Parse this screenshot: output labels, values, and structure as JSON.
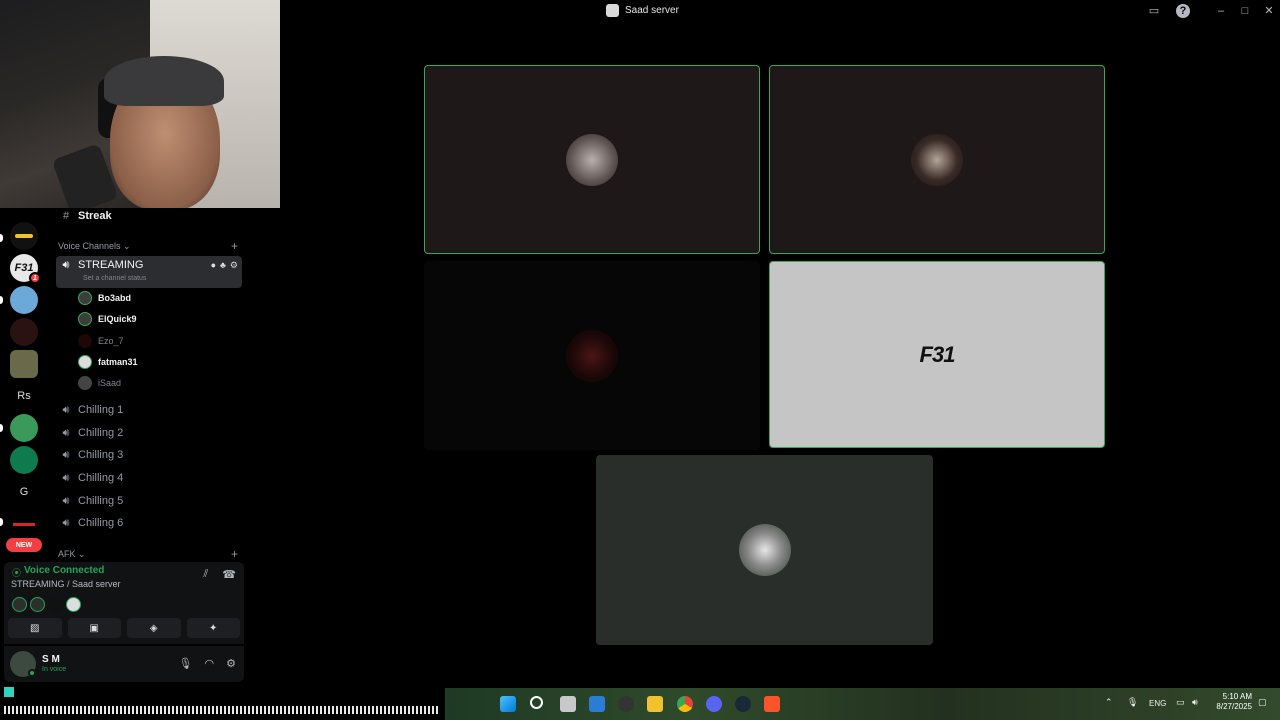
{
  "window": {
    "title": "Saad server"
  },
  "sidebar": {
    "text_channel": "Streak",
    "voice_category": "Voice Channels",
    "active_channel": {
      "name": "STREAMING",
      "status_placeholder": "Set a channel status",
      "members": [
        {
          "name": "Bo3abd",
          "speaking": true
        },
        {
          "name": "ElQuick9",
          "speaking": true
        },
        {
          "name": "Ezo_7",
          "speaking": false
        },
        {
          "name": "fatman31",
          "speaking": true
        },
        {
          "name": "iSaad",
          "speaking": false
        }
      ]
    },
    "voice_channels": [
      "Chilling 1",
      "Chilling 2",
      "Chilling 3",
      "Chilling 4",
      "Chilling 5",
      "Chilling 6"
    ],
    "afk_category": "AFK"
  },
  "servers": [
    {
      "icon": "server-1-icon"
    },
    {
      "label": "F31",
      "badge": "1"
    },
    {
      "icon": "server-3-icon"
    },
    {
      "icon": "server-4-icon"
    },
    {
      "icon": "server-5-icon"
    },
    {
      "label": "Rs"
    },
    {
      "icon": "server-7-icon"
    },
    {
      "icon": "server-8-icon"
    },
    {
      "label": "G"
    },
    {
      "icon": "server-10-icon"
    }
  ],
  "new_badge": "NEW",
  "voice_panel": {
    "title": "Voice Connected",
    "subtitle": "STREAMING / Saad server"
  },
  "user": {
    "name": "S M",
    "status": "In voice"
  },
  "video_tiles": {
    "f31_label": "F31"
  },
  "taskbar": {
    "lang": "ENG",
    "time": "5:10 AM",
    "date": "8/27/2025"
  },
  "colors": {
    "speaking_ring": "#3aa55d",
    "voice_connected": "#23a55a",
    "sidebar_bg": "#000000",
    "active_channel_bg": "#2b2d31"
  }
}
